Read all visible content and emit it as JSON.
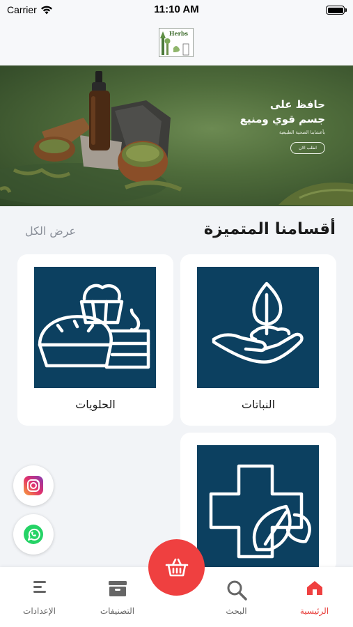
{
  "status_bar": {
    "carrier": "Carrier",
    "time": "11:10 AM",
    "battery_level": 1.0
  },
  "header": {
    "logo_text": "Herbs"
  },
  "banner": {
    "title_line1": "حافظ على",
    "title_line2": "جسم قوي ومنيع",
    "subtitle": "بأعشابنا الصحية الطبيعية",
    "button_label": "اطلب الان"
  },
  "section": {
    "title": "أقسامنا المتميزة",
    "view_all": "عرض الكل"
  },
  "categories": [
    {
      "label": "النباتات",
      "icon": "plant-in-hand-icon"
    },
    {
      "label": "الحلويات",
      "icon": "sweets-icon"
    },
    {
      "label": "",
      "icon": "medical-leaf-icon"
    }
  ],
  "floating": {
    "instagram_icon": "instagram-icon",
    "whatsapp_icon": "whatsapp-icon"
  },
  "tabbar": {
    "home": "الرئيسية",
    "search": "البحث",
    "categories": "التصنيفات",
    "settings": "الإعدادات",
    "cart_icon": "basket-icon"
  },
  "colors": {
    "accent": "#ef4040",
    "card_bg": "#0c4060",
    "banner": "#4f6c3b"
  }
}
